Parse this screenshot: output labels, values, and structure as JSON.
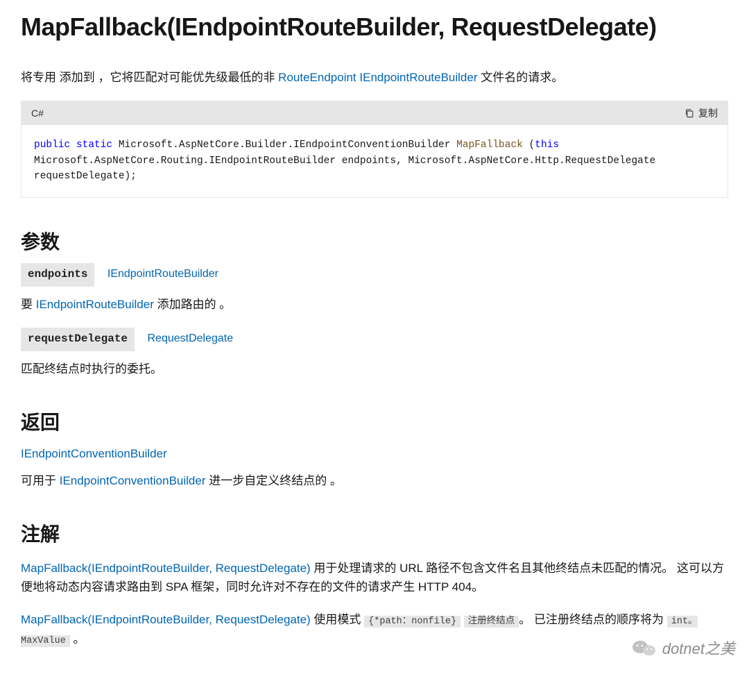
{
  "title": "MapFallback(IEndpointRouteBuilder, RequestDelegate)",
  "intro": {
    "prefix": "将专用 添加到 ，它将匹配对可能优先级最低的非 ",
    "link1": "RouteEndpoint",
    "link2": "IEndpointRouteBuilder",
    "suffix": " 文件名的请求。"
  },
  "code": {
    "lang": "C#",
    "copy": "复制",
    "kw_public": "public",
    "kw_static": "static",
    "seg1": " Microsoft.AspNetCore.Builder.IEndpointConventionBuilder ",
    "fn": "MapFallback",
    "seg_open": " (",
    "kw_this": "this",
    "seg2": " Microsoft.AspNetCore.Routing.IEndpointRouteBuilder endpoints, Microsoft.AspNetCore.Http.RequestDelegate requestDelegate);"
  },
  "params": {
    "heading": "参数",
    "p1_name": "endpoints",
    "p1_type": "IEndpointRouteBuilder",
    "p1_desc_pre": "要 ",
    "p1_desc_link": "IEndpointRouteBuilder",
    "p1_desc_post": " 添加路由的 。",
    "p2_name": "requestDelegate",
    "p2_type": "RequestDelegate",
    "p2_desc": "匹配终结点时执行的委托。"
  },
  "returns": {
    "heading": "返回",
    "link": "IEndpointConventionBuilder",
    "desc_pre": "可用于 ",
    "desc_link": "IEndpointConventionBuilder",
    "desc_post": " 进一步自定义终结点的 。"
  },
  "notes": {
    "heading": "注解",
    "p1_link": "MapFallback(IEndpointRouteBuilder, RequestDelegate)",
    "p1_rest": " 用于处理请求的 URL 路径不包含文件名且其他终结点未匹配的情况。 这可以方便地将动态内容请求路由到 SPA 框架，同时允许对不存在的文件的请求产生 HTTP 404。",
    "p2_link": "MapFallback(IEndpointRouteBuilder, RequestDelegate)",
    "p2_mid1": " 使用模式 ",
    "p2_code1": "{*path：nonfile}",
    "p2_code1b": "注册终结点",
    "p2_mid2": "。 已注册终结点的顺序将为 ",
    "p2_code2": "int。MaxValue",
    "p2_end": " 。"
  },
  "watermark": "dotnet之美"
}
